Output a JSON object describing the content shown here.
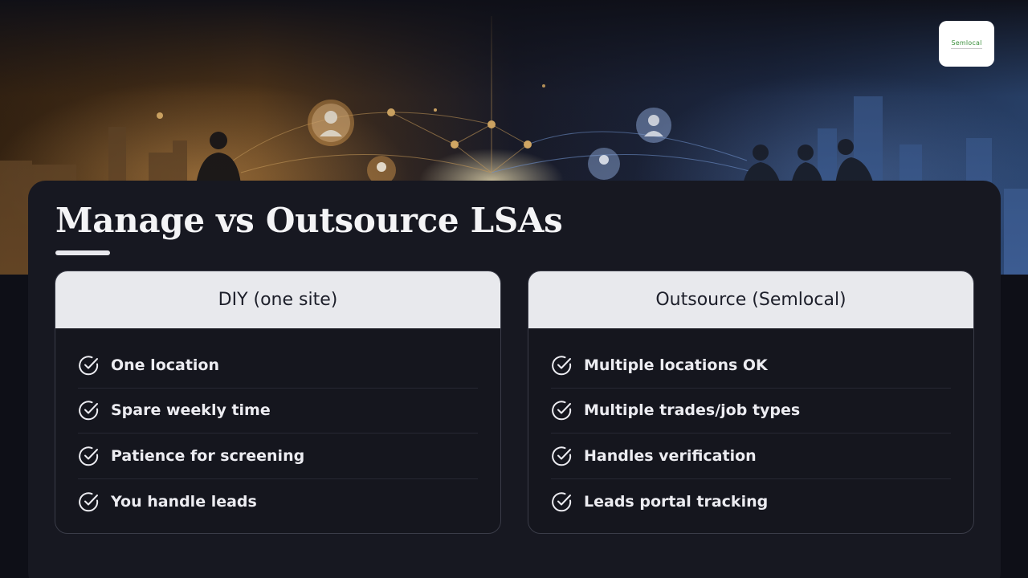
{
  "brand": {
    "logo_text": "Semlocal"
  },
  "slide": {
    "title": "Manage vs Outsource LSAs"
  },
  "columns": [
    {
      "heading": "DIY (one site)",
      "items": [
        "One location",
        "Spare weekly time",
        "Patience for screening",
        "You handle leads"
      ]
    },
    {
      "heading": "Outsource (Semlocal)",
      "items": [
        "Multiple locations OK",
        "Multiple trades/job types",
        "Handles verification",
        "Leads portal tracking"
      ]
    }
  ],
  "colors": {
    "background": "#0e0f17",
    "panel": "#171821",
    "card_header": "#e8e9ed",
    "warm_glow": "#e0a050",
    "cool_glow": "#5a8ad8"
  },
  "icons": {
    "bullet": "check-circle-icon",
    "node": "person-icon"
  }
}
